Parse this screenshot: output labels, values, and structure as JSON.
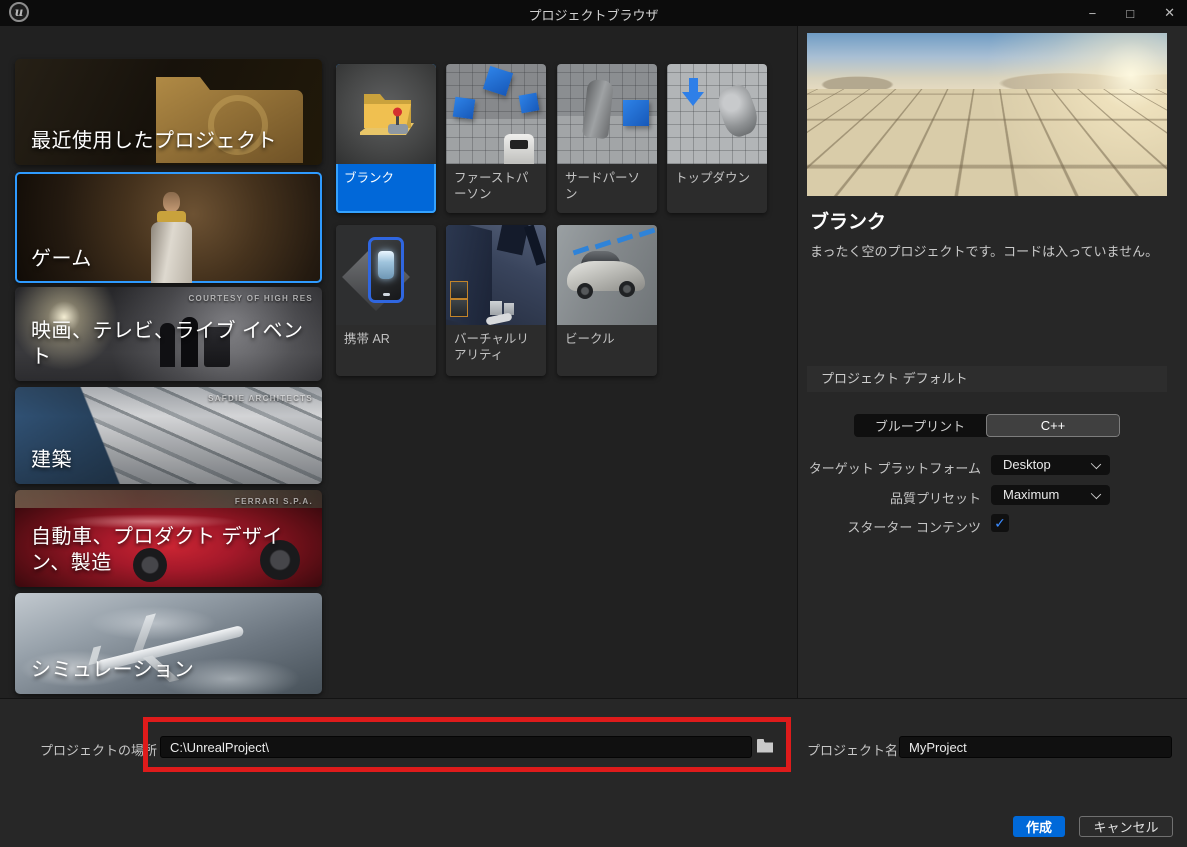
{
  "titlebar": {
    "title": "プロジェクトブラウザ",
    "logo_letter": "u",
    "minimize": "−",
    "maximize": "□",
    "close": "✕"
  },
  "sidebar": {
    "items": [
      {
        "label": "最近使用したプロジェクト",
        "badge": "",
        "selected": false
      },
      {
        "label": "ゲーム",
        "badge": "",
        "selected": true
      },
      {
        "label": "映画、テレビ、ライブ イベント",
        "badge": "COURTESY OF HIGH RES",
        "selected": false
      },
      {
        "label": "建築",
        "badge": "SAFDIE ARCHITECTS",
        "selected": false
      },
      {
        "label": "自動車、プロダクト デザイン、製造",
        "badge": "FERRARI S.P.A.",
        "selected": false
      },
      {
        "label": "シミュレーション",
        "badge": "",
        "selected": false
      }
    ]
  },
  "templates": {
    "items": [
      {
        "label": "ブランク",
        "selected": true
      },
      {
        "label": "ファーストパーソン",
        "selected": false
      },
      {
        "label": "サードパーソン",
        "selected": false
      },
      {
        "label": "トップダウン",
        "selected": false
      },
      {
        "label": "携帯 AR",
        "selected": false
      },
      {
        "label": "バーチャルリアリティ",
        "selected": false
      },
      {
        "label": "ビークル",
        "selected": false
      }
    ]
  },
  "detail": {
    "title": "ブランク",
    "description": "まったく空のプロジェクトです。コードは入っていません。",
    "defaults": {
      "header": "プロジェクト デフォルト",
      "language_options": [
        "ブループリント",
        "C++"
      ],
      "language_selected": "C++",
      "target_platform_label": "ターゲット プラットフォーム",
      "target_platform_value": "Desktop",
      "quality_label": "品質プリセット",
      "quality_value": "Maximum",
      "starter_content_label": "スターター コンテンツ",
      "starter_content_checked": true
    }
  },
  "footer": {
    "location_label": "プロジェクトの場所",
    "location_value": "C:\\UnrealProject\\",
    "name_label": "プロジェクト名",
    "name_value": "MyProject",
    "create_label": "作成",
    "cancel_label": "キャンセル"
  },
  "icons": {
    "check": "✓"
  },
  "colors": {
    "accent_blue": "#0069d9",
    "selection_border": "#2f9bff",
    "template_selected_fill": "#0168d9",
    "annotation_red": "#de1b1b"
  }
}
